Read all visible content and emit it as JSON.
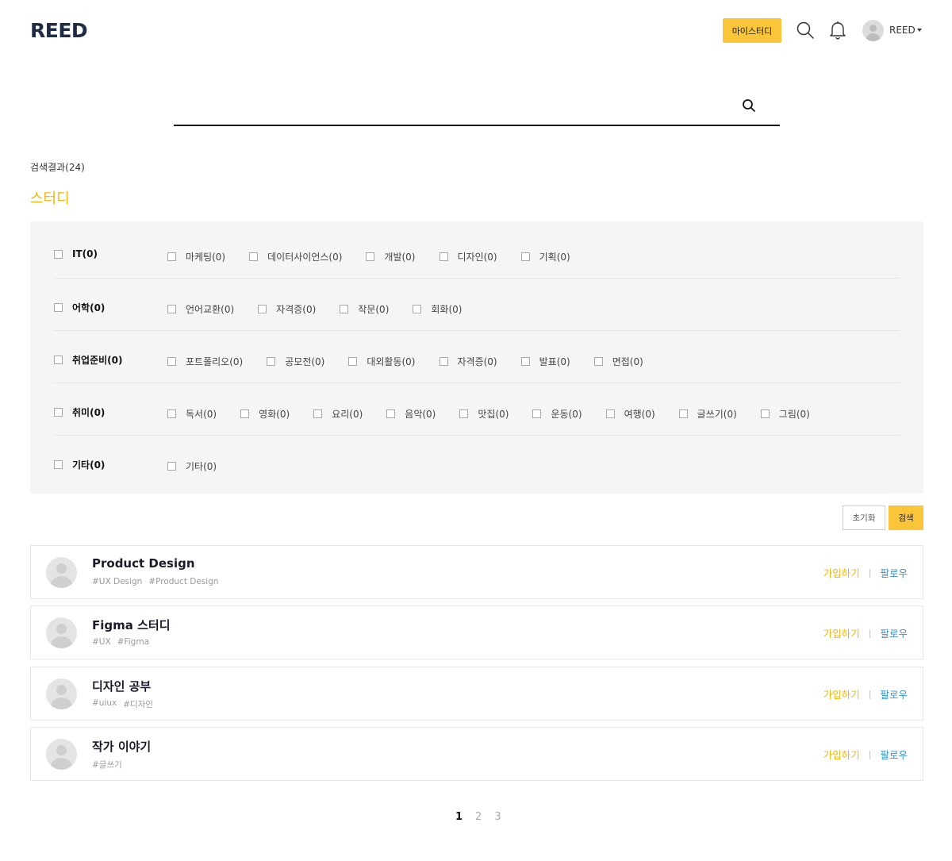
{
  "header": {
    "logo": "REED",
    "mystudy_label": "마이스터디",
    "user_name": "REED"
  },
  "search": {
    "value": "",
    "placeholder": ""
  },
  "results": {
    "count_label": "검색결과(24)",
    "section_title": "스터디"
  },
  "filters": [
    {
      "label": "IT(0)",
      "subs": [
        "마케팅(0)",
        "데이터사이언스(0)",
        "개발(0)",
        "디자인(0)",
        "기획(0)"
      ]
    },
    {
      "label": "어학(0)",
      "subs": [
        "언어교환(0)",
        "자격증(0)",
        "작문(0)",
        "회화(0)"
      ]
    },
    {
      "label": "취업준비(0)",
      "subs": [
        "포트폴리오(0)",
        "공모전(0)",
        "대외활동(0)",
        "자격증(0)",
        "발표(0)",
        "면접(0)"
      ]
    },
    {
      "label": "취미(0)",
      "subs": [
        "독서(0)",
        "영화(0)",
        "요리(0)",
        "음악(0)",
        "맛집(0)",
        "운동(0)",
        "여행(0)",
        "글쓰기(0)",
        "그림(0)"
      ]
    },
    {
      "label": "기타(0)",
      "subs": [
        "기타(0)"
      ]
    }
  ],
  "buttons": {
    "reset": "초기화",
    "search": "검색"
  },
  "studies": [
    {
      "title": "Product Design",
      "tags": [
        "#UX Design",
        "#Product Design"
      ],
      "join": "가입하기",
      "sep": "|",
      "follow": "팔로우"
    },
    {
      "title": "Figma 스터디",
      "tags": [
        "#UX",
        "#Figma"
      ],
      "join": "가입하기",
      "sep": "|",
      "follow": "팔로우"
    },
    {
      "title": "디자인 공부",
      "tags": [
        "#uiux",
        "#디자인"
      ],
      "join": "가입하기",
      "sep": "|",
      "follow": "팔로우"
    },
    {
      "title": "작가 이야기",
      "tags": [
        "#글쓰기"
      ],
      "join": "가입하기",
      "sep": "|",
      "follow": "팔로우"
    }
  ],
  "pagination": {
    "pages": [
      "1",
      "2",
      "3"
    ],
    "current": 1
  },
  "colors": {
    "accent": "#fbc53a",
    "accent_text": "#f2b60c",
    "follow": "#3b8fd6",
    "panel_bg": "#f5f5f5"
  },
  "icons": [
    "search-icon",
    "bell-icon",
    "avatar",
    "caret-down-icon",
    "checkbox"
  ]
}
